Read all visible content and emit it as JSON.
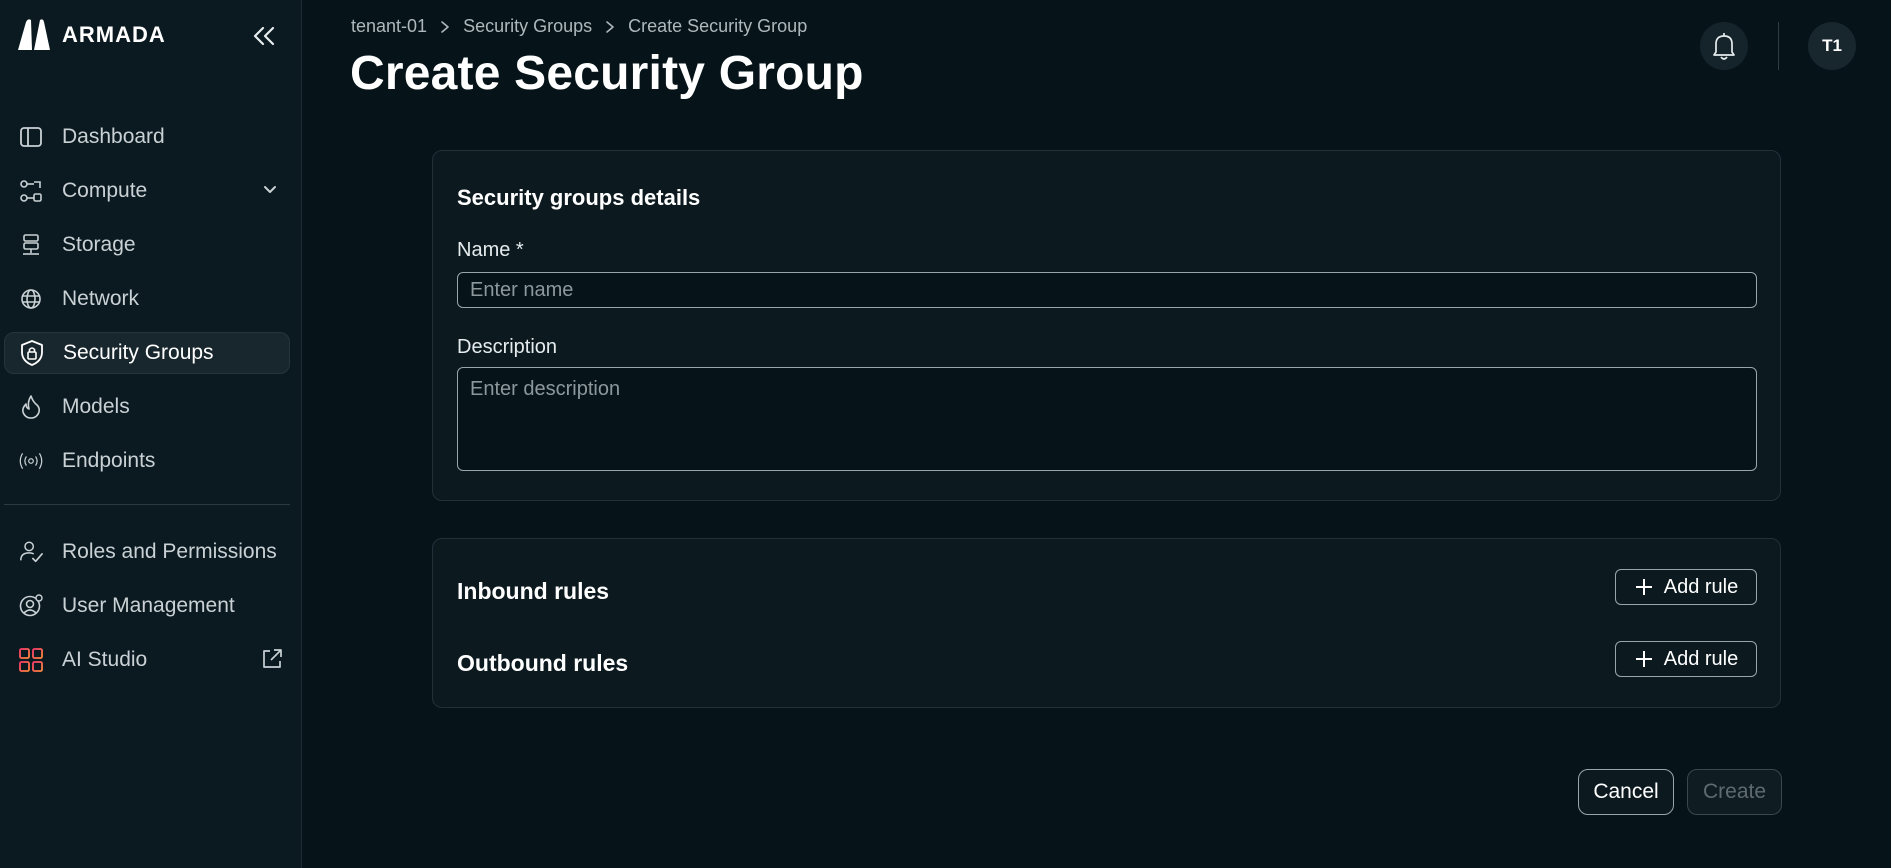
{
  "brand": {
    "name": "ARMADA"
  },
  "sidebar": {
    "items": [
      {
        "label": "Dashboard",
        "icon": "sidebar-layout-icon"
      },
      {
        "label": "Compute",
        "icon": "compute-nodes-icon",
        "expandable": true
      },
      {
        "label": "Storage",
        "icon": "server-icon"
      },
      {
        "label": "Network",
        "icon": "globe-icon"
      },
      {
        "label": "Security Groups",
        "icon": "shield-lock-icon",
        "active": true
      },
      {
        "label": "Models",
        "icon": "flame-icon"
      },
      {
        "label": "Endpoints",
        "icon": "broadcast-icon"
      }
    ],
    "secondary_items": [
      {
        "label": "Roles and Permissions",
        "icon": "user-check-icon"
      },
      {
        "label": "User Management",
        "icon": "user-settings-icon"
      },
      {
        "label": "AI Studio",
        "icon": "ai-studio-grid-icon",
        "external": true
      }
    ]
  },
  "breadcrumb": [
    "tenant-01",
    "Security Groups",
    "Create Security Group"
  ],
  "page": {
    "title": "Create Security Group"
  },
  "header": {
    "avatar_initials": "T1"
  },
  "details": {
    "title": "Security groups details",
    "name_label": "Name *",
    "name_placeholder": "Enter name",
    "name_value": "",
    "description_label": "Description",
    "description_placeholder": "Enter description",
    "description_value": ""
  },
  "rules": {
    "inbound_title": "Inbound rules",
    "outbound_title": "Outbound rules",
    "add_rule_label": "Add rule"
  },
  "footer": {
    "cancel_label": "Cancel",
    "create_label": "Create"
  },
  "colors": {
    "background": "#06141a",
    "sidebar": "#0b1a21",
    "card": "#0c1a20",
    "border": "#223139",
    "ai_studio_gradient": [
      "#ff3b6b",
      "#ff8a3d"
    ]
  }
}
